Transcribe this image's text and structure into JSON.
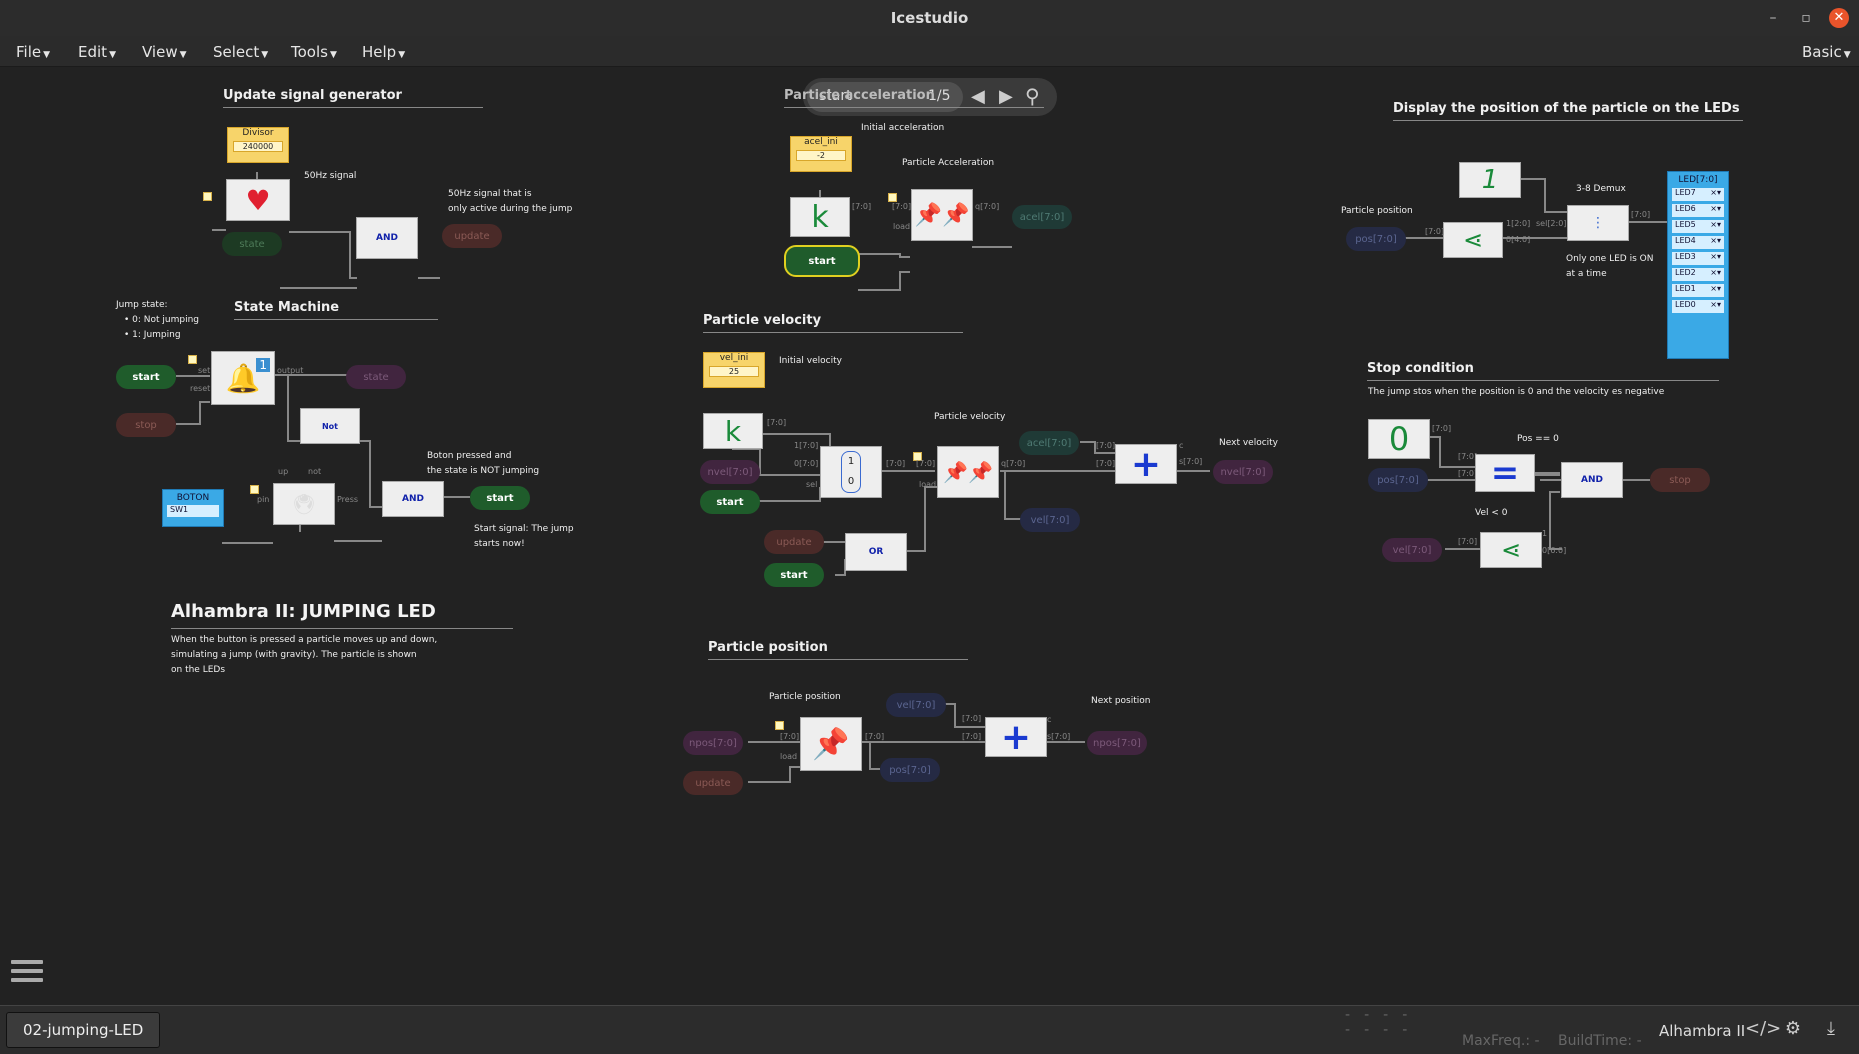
{
  "window": {
    "title": "Icestudio"
  },
  "menu": [
    {
      "id": "file",
      "label": "File"
    },
    {
      "id": "edit",
      "label": "Edit"
    },
    {
      "id": "view",
      "label": "View"
    },
    {
      "id": "select",
      "label": "Select"
    },
    {
      "id": "tools",
      "label": "Tools"
    },
    {
      "id": "help",
      "label": "Help"
    }
  ],
  "menu_right": {
    "label": "Basic"
  },
  "search": {
    "query": "start",
    "count": "1/5"
  },
  "sections": {
    "update": "Update signal generator",
    "accel": "Particle acceleration",
    "display": "Display the position of the particle on the LEDs",
    "state_machine": "State Machine",
    "velocity": "Particle velocity",
    "stop": "Stop condition",
    "position": "Particle position"
  },
  "project": {
    "title": "Alhambra II: JUMPING LED",
    "desc1": "When the button is pressed a particle moves up and down,",
    "desc2": "simulating a jump (with gravity). The particle is shown",
    "desc3": "on the LEDs"
  },
  "comments": {
    "sig50": "50Hz signal",
    "sig50_only1": "50Hz signal that is",
    "sig50_only2": "only active during the jump",
    "init_acc": "Initial acceleration",
    "part_acc": "Particle Acceleration",
    "jump_state": "Jump state:",
    "not_jumping": "0: Not jumping",
    "jumping": "1: Jumping",
    "boton1": "Boton pressed and",
    "boton2": "the state is NOT jumping",
    "start1": "Start signal: The jump",
    "start2": "starts now!",
    "init_vel": "Initial velocity",
    "part_vel": "Particle velocity",
    "next_vel": "Next velocity",
    "part_pos": "Particle position",
    "next_pos": "Next position",
    "demux": "3-8 Demux",
    "part_pos2": "Particle position",
    "one_led1": "Only one LED is ON",
    "one_led2": "at a time",
    "stop_desc": "The jump stos when the position is 0 and the velocity es negative",
    "pos0": "Pos == 0",
    "velneg": "Vel < 0"
  },
  "blocks": {
    "divisor": {
      "label": "Divisor",
      "value": "240000"
    },
    "acel_ini": {
      "label": "acel_ini",
      "value": "-2"
    },
    "vel_ini": {
      "label": "vel_ini",
      "value": "25"
    },
    "boton": {
      "label": "BOTON",
      "value": "SW1"
    },
    "and": "AND",
    "not": "Not",
    "or": "OR",
    "k": "k",
    "const1": "1",
    "const0": "0",
    "mux1": "1",
    "mux0": "0",
    "led": {
      "label": "LED[7:0]",
      "items": [
        "LED7",
        "LED6",
        "LED5",
        "LED4",
        "LED3",
        "LED2",
        "LED1",
        "LED0"
      ]
    }
  },
  "labels": {
    "start": "start",
    "stop": "stop",
    "state": "state",
    "update": "update",
    "acel_out": "acel[7:0]",
    "nvel": "nvel[7:0]",
    "vel": "vel[7:0]",
    "acel": "acel[7:0]",
    "npos": "npos[7:0]",
    "pos": "pos[7:0]"
  },
  "ports": {
    "p70": "[7:0]",
    "q70": "q[7:0]",
    "load": "load",
    "set": "set",
    "reset": "reset",
    "output": "output",
    "sel": "sel",
    "i1": "1[7:0]",
    "i0": "0[7:0]",
    "sel20": "sel[2:0]",
    "i120": "1[2:0]",
    "o40": "0[4:0]",
    "s70": "s[7:0]",
    "c": "c",
    "o60": "0[6:0]",
    "one": "1",
    "pin": "pin",
    "press": "Press",
    "s": "s",
    "up": "up",
    "not": "not"
  },
  "status": {
    "file": "02-jumping-LED",
    "maxfreq": "MaxFreq.: -",
    "buildtime": "BuildTime: -",
    "board": "Alhambra II",
    "dashes": "-"
  },
  "icons": [
    "minimize-icon",
    "maximize-icon",
    "close-icon",
    "search-icon",
    "prev-icon",
    "next-icon",
    "hamburger-icon",
    "code-icon",
    "settings-icon",
    "download-icon"
  ],
  "colors": {
    "background": "#222222",
    "start_pill": "#1f5c2b",
    "led_block": "#3aa9e6",
    "const_block": "#f7d46a",
    "highlight": "#e0d020"
  }
}
